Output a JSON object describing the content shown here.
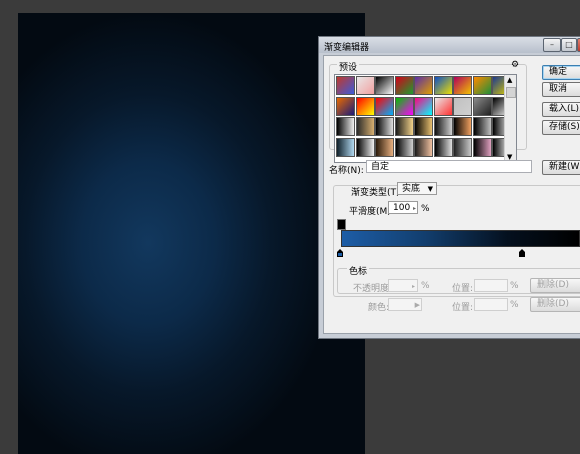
{
  "dialog": {
    "title": "渐变编辑器",
    "presets_label": "预设",
    "buttons": {
      "ok": "确定",
      "cancel": "取消",
      "load": "载入(L)...",
      "save": "存储(S)...",
      "new": "新建(W)"
    },
    "name_label": "名称(N):",
    "name_value": "自定",
    "gradient_type_label": "渐变类型(T):",
    "gradient_type_value": "实底",
    "smoothness_label": "平滑度(M):",
    "smoothness_value": "100",
    "percent": "%",
    "color_stops_label": "色标",
    "opacity_label": "不透明度:",
    "location_label": "位置:",
    "delete_label": "删除(D)",
    "color_label": "颜色:"
  },
  "gradient": {
    "start_color": "#1d5da6",
    "end_color": "#000000"
  },
  "presets": [
    [
      "#c0392b,#3b5bdb",
      "#e8e8e8,#f2a0a0",
      "#000,#fff",
      "#d4001a,#1b9e2f",
      "#5a2ea6,#e0a000",
      "#0d4fc4,#f0e000",
      "#b0005a,#f2c400",
      "#ff8a00,#1e8f3a",
      "#1d3a8f,#e0d000"
    ],
    [
      "#e86a00,#1a1a7a",
      "#ff0000,#ffff00",
      "#ff0000,#00b0ff",
      "#00c000,#ff00ff",
      "#ff0080,#00ffff",
      "#e8e8e8,#ff3030",
      "#c0c0c0,#d0d0d0",
      "#8a8a8a,#202020",
      "#000,#f0f0f0"
    ],
    [
      "#000,#f0f0f0",
      "#2a2a2a,#d8b070",
      "#000,#e0e0e0",
      "#1a1a1a,#f2d28a",
      "#000,#e8c070",
      "#101010,#d0d0d0",
      "#000,#f0a060",
      "#000,#c0c0c0",
      "#000,#f0f0f0"
    ],
    [
      "#10202a,#b0d8f0",
      "#000,#f0f0f0",
      "#2a1a0a,#e8b080",
      "#000,#d0d0d0",
      "#1a1a1a,#f0c0a0",
      "#000,#e0e0e0",
      "#202020,#c8c8c8",
      "#000,#e0a0c0",
      "#000,#ffffff"
    ]
  ]
}
